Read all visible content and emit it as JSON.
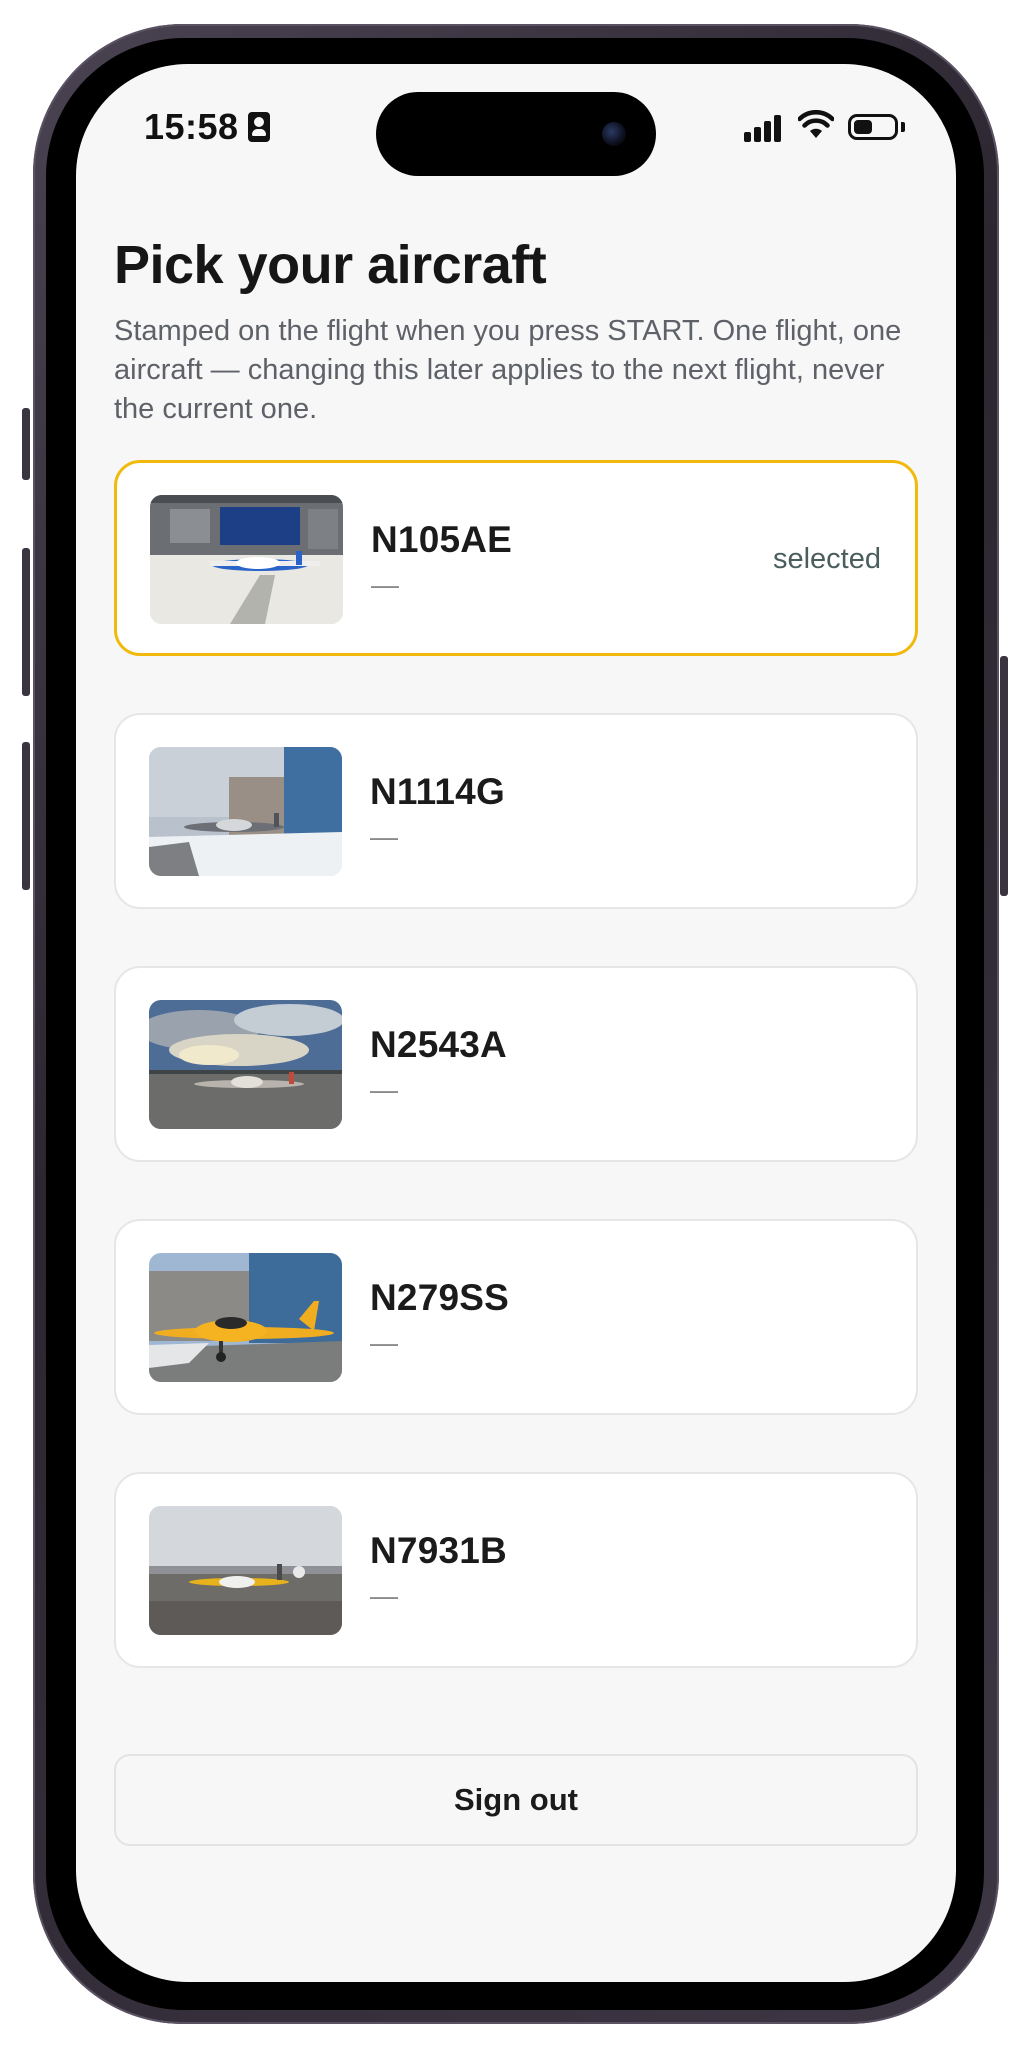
{
  "status_bar": {
    "time": "15:58",
    "contact_icon": "person-card-icon",
    "signal_icon": "cellular-signal-icon",
    "wifi_icon": "wifi-icon",
    "battery_icon": "battery-icon"
  },
  "header": {
    "title": "Pick your aircraft",
    "subtitle": "Stamped on the flight when you press START. One flight, one aircraft — changing this later applies to the next flight, never the current one."
  },
  "aircraft": [
    {
      "registration": "N105AE",
      "detail": "—",
      "selected": true,
      "status_label": "selected",
      "photo": "hangar-aircraft-photo"
    },
    {
      "registration": "N1114G",
      "detail": "—",
      "selected": false,
      "status_label": "",
      "photo": "snowy-ramp-aircraft-photo"
    },
    {
      "registration": "N2543A",
      "detail": "—",
      "selected": false,
      "status_label": "",
      "photo": "cloudy-sky-aircraft-photo"
    },
    {
      "registration": "N279SS",
      "detail": "—",
      "selected": false,
      "status_label": "",
      "photo": "yellow-aircraft-photo"
    },
    {
      "registration": "N7931B",
      "detail": "—",
      "selected": false,
      "status_label": "",
      "photo": "airfield-aircraft-photo"
    }
  ],
  "footer": {
    "signout_label": "Sign out"
  },
  "colors": {
    "selected_border": "#f2b90d",
    "background": "#f7f7f7",
    "card_background": "#ffffff",
    "title_text": "#161616",
    "subtitle_text": "#5e6268",
    "selected_label_text": "#4a5e5e"
  }
}
